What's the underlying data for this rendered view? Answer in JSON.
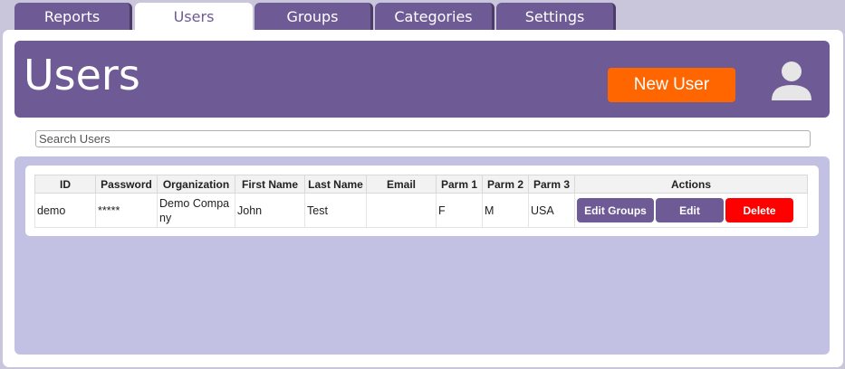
{
  "tabs": [
    {
      "label": "Reports"
    },
    {
      "label": "Users"
    },
    {
      "label": "Groups"
    },
    {
      "label": "Categories"
    },
    {
      "label": "Settings"
    }
  ],
  "active_tab": "Users",
  "header": {
    "title": "Users",
    "new_user_label": "New User",
    "avatar_icon": "user-avatar-icon"
  },
  "search": {
    "placeholder": "Search Users",
    "value": ""
  },
  "table": {
    "columns": [
      "ID",
      "Password",
      "Organization",
      "First Name",
      "Last Name",
      "Email",
      "Parm 1",
      "Parm 2",
      "Parm 3",
      "Actions"
    ],
    "rows": [
      {
        "id": "demo",
        "password": "*****",
        "organization": "Demo Company",
        "first_name": "John",
        "last_name": "Test",
        "email": "",
        "parm1": "F",
        "parm2": "M",
        "parm3": "USA",
        "actions": {
          "edit_groups": "Edit Groups",
          "edit": "Edit",
          "delete": "Delete"
        }
      }
    ]
  },
  "colors": {
    "brand_purple": "#6e5a95",
    "accent_orange": "#ff6600",
    "danger_red": "#ff0000",
    "content_bg": "#c3c1e3"
  }
}
